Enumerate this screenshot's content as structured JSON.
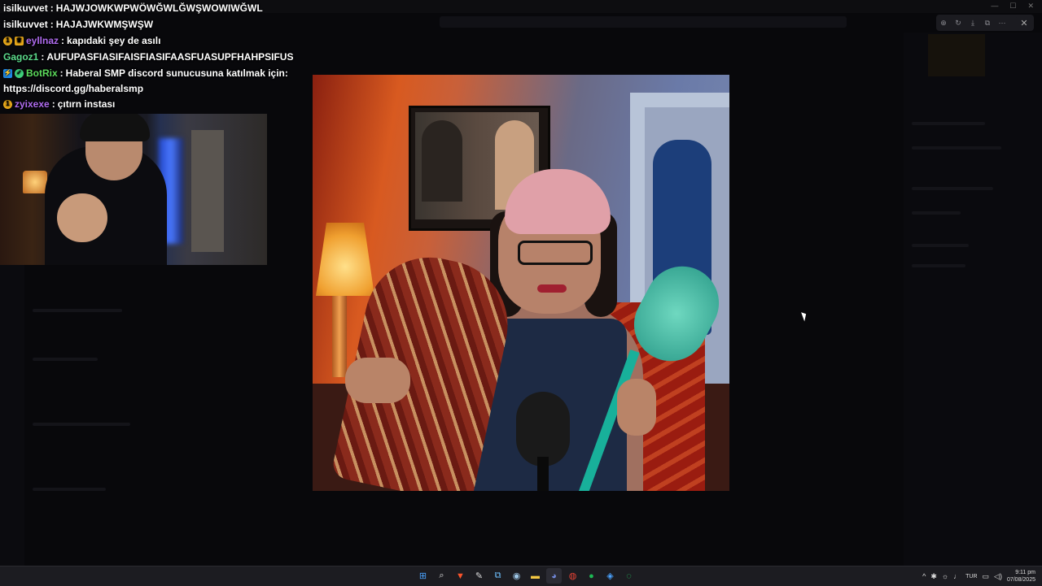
{
  "chat": {
    "messages": [
      {
        "user": "isilkuvvet",
        "user_color": "#ffffff",
        "badges": [],
        "text": "HAJWJOWKWPWÖWĞWLĞWŞWOWIWĞWL"
      },
      {
        "user": "isilkuvvet",
        "user_color": "#ffffff",
        "badges": [],
        "text": "HAJAJWKWMŞWŞW"
      },
      {
        "user": "eyllnaz",
        "user_color": "#b06cf0",
        "badges": [
          "gold-bits",
          "crown"
        ],
        "text": "kapıdaki şey de asılı"
      },
      {
        "user": "Gagoz1",
        "user_color": "#5cdb8c",
        "badges": [],
        "text": "AUFUPASFIASIFAISFIASIFAASFUASUPFHAHPSIFUS"
      },
      {
        "user": "BotRix",
        "user_color": "#5cdb5c",
        "badges": [
          "bot",
          "verified"
        ],
        "text": "Haberal SMP discord sunucusuna katılmak için:",
        "text_cont": "https://discord.gg/haberalsmp"
      },
      {
        "user": "zyixexe",
        "user_color": "#b06cf0",
        "badges": [
          "gold-bits"
        ],
        "text": "çıtırn instası"
      }
    ],
    "separator": ":"
  },
  "viewer": {
    "tools": [
      "zoom-icon",
      "rotate-icon",
      "download-icon",
      "external-icon",
      "more-icon"
    ],
    "close_icon": "close-icon"
  },
  "taskbar": {
    "apps": [
      {
        "name": "windows-start-icon",
        "glyph": "⊞",
        "color": "#4aa3ff"
      },
      {
        "name": "search-icon",
        "glyph": "⌕",
        "color": "#dddddd"
      },
      {
        "name": "brave-icon",
        "glyph": "▼",
        "color": "#fb542b"
      },
      {
        "name": "pen-app-icon",
        "glyph": "✎",
        "color": "#dddddd"
      },
      {
        "name": "network-app-icon",
        "glyph": "⧉",
        "color": "#6ec1ff"
      },
      {
        "name": "steam-icon",
        "glyph": "◉",
        "color": "#9ec7e8"
      },
      {
        "name": "explorer-icon",
        "glyph": "▬",
        "color": "#f5c842"
      },
      {
        "name": "discord-icon",
        "glyph": "◕",
        "color": "#7289da"
      },
      {
        "name": "chrome-icon",
        "glyph": "◍",
        "color": "#ea4335"
      },
      {
        "name": "spotify-icon",
        "glyph": "●",
        "color": "#1db954"
      },
      {
        "name": "vpn-icon",
        "glyph": "◈",
        "color": "#4aa3ff"
      },
      {
        "name": "whatsapp-icon",
        "glyph": "◌",
        "color": "#25d366"
      }
    ],
    "tray": {
      "lang": "TUR",
      "time": "9:11 pm",
      "date": "07/08/2025"
    }
  }
}
